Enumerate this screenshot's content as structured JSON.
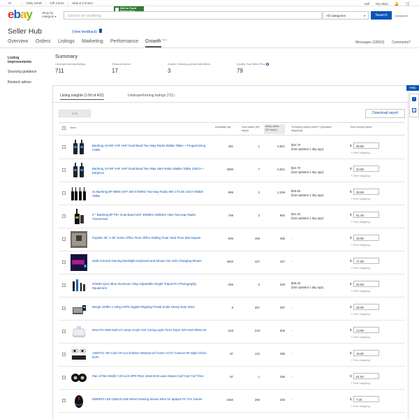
{
  "topbar": {
    "greeting": "Hi",
    "links": [
      "Daily Deals",
      "Gift Cards",
      "Help & Contact"
    ],
    "right": [
      "Sell",
      "My eBay"
    ],
    "cart_glyph": "🛒",
    "bell_glyph": "🔔"
  },
  "header": {
    "logo": {
      "e": "e",
      "b": "b",
      "a": "a",
      "y": "y"
    },
    "shop_by": "Shop by category",
    "promo_text": "Sell to Fund Spring Fun",
    "search_placeholder": "Search for anything",
    "category": "All Categories",
    "search_button": "Search",
    "advanced": "Advanced"
  },
  "page": {
    "title": "Seller Hub",
    "feedback": "(View feedback)"
  },
  "nav": {
    "tabs": [
      "Overview",
      "Orders",
      "Listings",
      "Marketing",
      "Performance",
      "Growth"
    ],
    "active": "Growth",
    "beta": "BETA",
    "messages": "Messages (33603)",
    "questions": "Comments?"
  },
  "sidebar": [
    "Listing improvements",
    "Sourcing guidance",
    "Restock advice"
  ],
  "summary": {
    "title": "Summary",
    "metrics": [
      {
        "label": "Underperforming listings",
        "value": "711"
      },
      {
        "label": "Restock advice",
        "value": "17"
      },
      {
        "label": "Invalid / missing product identifiers",
        "value": "3"
      },
      {
        "label": "Quality Top Rated Plus",
        "value": "79"
      }
    ]
  },
  "panel": {
    "tabs": [
      "Listing insights (1-50 of 422)",
      "Underperforming listings (711)"
    ],
    "edit": "Edit",
    "download": "Download report",
    "help": "Help"
  },
  "table": {
    "headers": {
      "item": "Item",
      "qty": "Available qty",
      "your_sales": "Your sales (90 days)",
      "ebay_sales": "eBay sales (90 days)",
      "trending": "Trending online price** (includes shipping)",
      "price": "Your current price"
    },
    "free_shipping": "+ Free shipping",
    "rows": [
      {
        "title": "Baofeng UV-5R VHF UHF Dual Band Two Way Radio Walkie Talkie + Programming Cable",
        "qty": "491",
        "sales": "1",
        "ebay": "6,821",
        "trend": "$24.70",
        "trend_note": "(last updated 1 day ago)",
        "price": "25.89",
        "thumb": "radio"
      },
      {
        "title": "Baofeng UV-5R VHF UHF Dual Band Two Way Ham Radio Walkie Talkie 128CH + Earpiece",
        "qty": "2595",
        "sales": "7",
        "ebay": "6,821",
        "trend": "$24.70",
        "trend_note": "(last updated 1 day ago)",
        "price": "24.99",
        "thumb": "radio"
      },
      {
        "title": "4x Baofeng BF-888S UHF 400-470MHz Two-way Radio 5W CTCSS 16CH Walkie Talkie",
        "qty": "999",
        "sales": "2",
        "ebay": "2,259",
        "trend": "$25.65",
        "trend_note": "(last updated 1 day ago)",
        "price": "39.99",
        "thumb": "radios"
      },
      {
        "title": "2 * Baofeng BF-F8+ Dual Band UHF 400MHz-480MHz Ham Two-way Radio Transceiver",
        "qty": "799",
        "sales": "0",
        "ebay": "892",
        "trend": "$41.32",
        "trend_note": "(last updated 1 day ago)",
        "price": "51.49",
        "thumb": "radio2"
      },
      {
        "title": "Popular 36\" x 48\" Home Office Floor Office Rolling Chair Hard Floor Mat Square",
        "qty": "995",
        "sales": "466",
        "ebay": "466",
        "trend": "-",
        "trend_note": "",
        "price": "15.99",
        "thumb": "mat"
      },
      {
        "title": "Multi-Colored Gaming Backlight Keyboard and Mouse Set LED Changing Mouse",
        "qty": "4640",
        "sales": "427",
        "ebay": "427",
        "trend": "-",
        "trend_note": "",
        "price": "17.99",
        "thumb": "keyboard"
      },
      {
        "title": "ZOMEI Q111 Blue Aluminum Alloy Adjustable Height Tripod Pro Photography Equipment",
        "qty": "256",
        "sales": "0",
        "ebay": "328",
        "trend": "$36.40",
        "trend_note": "(last updated 1 day ago)",
        "price": "22.69",
        "thumb": "tripod"
      },
      {
        "title": "Weigh 440lbs x 100g USPS Digital Shipping Postal Scale Heavy Duty Steel",
        "qty": "9",
        "sales": "397",
        "ebay": "397",
        "trend": "-",
        "trend_note": "",
        "price": "29.99",
        "thumb": "scale"
      },
      {
        "title": "New Pro 36W Nail UV Lamp Acrylic Gel Curing Light Timer Dryer SPA Nail White Kit",
        "qty": "619",
        "sales": "219",
        "ebay": "305",
        "trend": "-",
        "trend_note": "",
        "price": "14.99",
        "thumb": "lamp"
      },
      {
        "title": "1300TVL HD Color IR-Cut Outdoor Waterproof Home CCTV Camera IR Night Vision DVR",
        "qty": "87",
        "sales": "142",
        "ebay": "285",
        "trend": "-",
        "trend_note": "",
        "price": "19.95",
        "thumb": "camera"
      },
      {
        "title": "Pair of Rim Width 7.00 inch 4PR P512 18x8.50-8 Lawn Mower Golf Cart Turf Tires",
        "qty": "87",
        "sales": "1",
        "ebay": "295",
        "trend": "-",
        "trend_note": "",
        "price": "61.62",
        "thumb": "tires"
      },
      {
        "title": "5500DPI LED Optical USB Wired Gaming Mouse Mice for laptops PC Pro Gamer",
        "qty": "1650",
        "sales": "260",
        "ebay": "260",
        "trend": "-",
        "trend_note": "",
        "price": "7.25",
        "thumb": "mouse"
      }
    ]
  }
}
